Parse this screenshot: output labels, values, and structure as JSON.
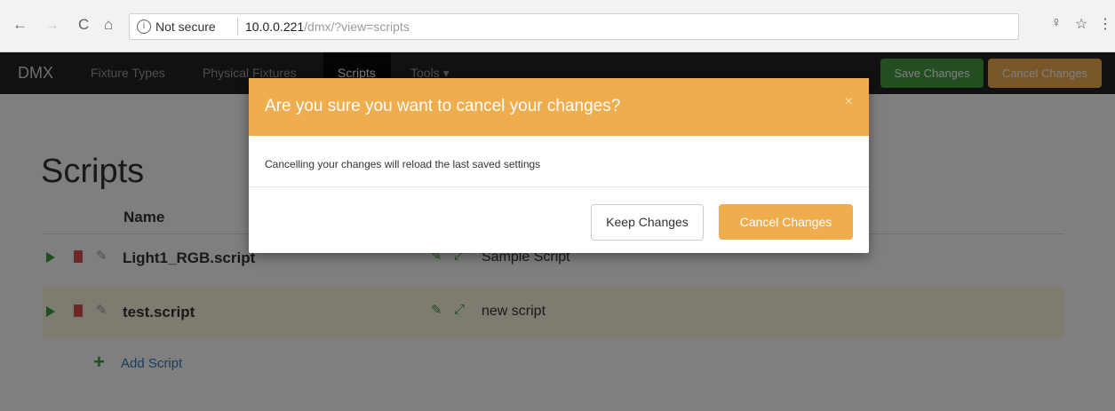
{
  "browser": {
    "back_icon": "←",
    "forward_icon": "→",
    "reload_icon": "C",
    "home_icon": "⌂",
    "info_icon": "i",
    "security_label": "Not secure",
    "url_host": "10.0.0.221",
    "url_path": "/dmx/?view=scripts",
    "key_icon": "♀",
    "star_icon": "☆",
    "menu_icon": "⋮"
  },
  "navbar": {
    "brand": "DMX",
    "items": [
      {
        "label": "Fixture Types"
      },
      {
        "label": "Physical Fixtures"
      },
      {
        "label": "Scripts"
      },
      {
        "label": "Tools ▾"
      }
    ],
    "save_label": "Save Changes",
    "cancel_label": "Cancel Changes",
    "colors": {
      "save": "#449d44",
      "cancel": "#f0ad4e",
      "bar": "#222222"
    }
  },
  "main": {
    "title": "Scripts",
    "column_name": "Name",
    "scripts": [
      {
        "name": "Light1_RGB.script",
        "description": "Sample Script"
      },
      {
        "name": "test.script",
        "description": "new script"
      }
    ],
    "add_label": "Add Script",
    "add_icon": "+"
  },
  "modal": {
    "title": "Are you sure you want to cancel your changes?",
    "close_icon": "×",
    "body": "Cancelling your changes will reload the last saved settings",
    "keep_label": "Keep Changes",
    "cancel_label": "Cancel Changes",
    "accent": "#f0ad4e"
  }
}
